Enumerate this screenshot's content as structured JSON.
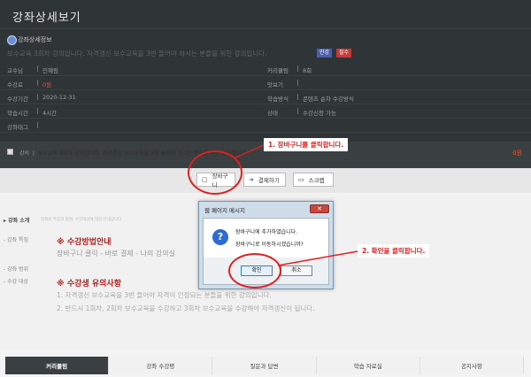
{
  "page": {
    "title": "강좌상세보기"
  },
  "section": {
    "label": "강좌상세정보",
    "icon": "course-icon"
  },
  "course": {
    "description": "보수교육 3회차 강의입니다. 자격갱신 보수교육을 3번 들어야 하시는 분들을 위한 강의입니다.",
    "badge_blue": "인강",
    "badge_red": "필수"
  },
  "info": {
    "rows": [
      {
        "l_label": "교수님",
        "l_value": "민혜림",
        "r_label": "커리큘럼",
        "r_value": "8회"
      },
      {
        "l_label": "수강료",
        "l_value": "0원",
        "r_label": "맛보기",
        "r_value": ""
      },
      {
        "l_label": "수강기간",
        "l_value": "2020-12-31",
        "r_label": "학습방식",
        "r_value": "콘텐츠 순차 수강방식"
      },
      {
        "l_label": "학습시간",
        "l_value": "4시간",
        "r_label": "상태",
        "r_value": "수강신청 가능"
      },
      {
        "l_label": "강좌태그",
        "l_value": "",
        "r_label": "",
        "r_value": ""
      }
    ]
  },
  "cart_item": {
    "type_label": "강의",
    "name": "보수교육 3회차 강의입니다. 자격갱신 보수교육을 3번 들어야 하시는 분들을 위한 강의입니다.",
    "price": "0원"
  },
  "actions": {
    "cart": "장바구니",
    "pay": "결제하기",
    "scrap": "스크랩"
  },
  "left_menu": {
    "intro": "강좌 소개",
    "intro_sub": "강좌의 특징과 범위, 수강대상에 대한 안내입니다",
    "feature": "강좌 특징",
    "scope": "강좌 범위",
    "target": "수강 대상"
  },
  "guide": {
    "title": "※ 수강방법안내",
    "text": "장바구니 클릭 - 바로 결제 - 나의 강의실"
  },
  "notice": {
    "title": "※ 수강생 유의사항",
    "line1": "1. 자격갱신 보수교육을 3번 들어야 자격이 인정되는 분들을 위한 강의입니다.",
    "line2": "2. 반드시 1회차, 2회차 보수교육을 수강하고 3회차 보수교육을 수강해야 자격갱신이 됩니다."
  },
  "tabs": [
    "커리큘럼",
    "강좌 수강평",
    "질문과 답변",
    "학습 자료실",
    "공지사항"
  ],
  "dialog": {
    "title": "웹 페이지 메시지",
    "message1": "장바구니에 추가하였습니다.",
    "message2": "장바구니로 이동하시겠습니까?",
    "ok": "확인",
    "cancel": "취소"
  },
  "annotations": {
    "step1": "1. 장바구니를 클릭합니다.",
    "step2": "2. 확인을 클릭합니다."
  },
  "colors": {
    "annotation": "#e02020",
    "dark_bg": "#2f3436",
    "accent_red": "#b12424"
  }
}
